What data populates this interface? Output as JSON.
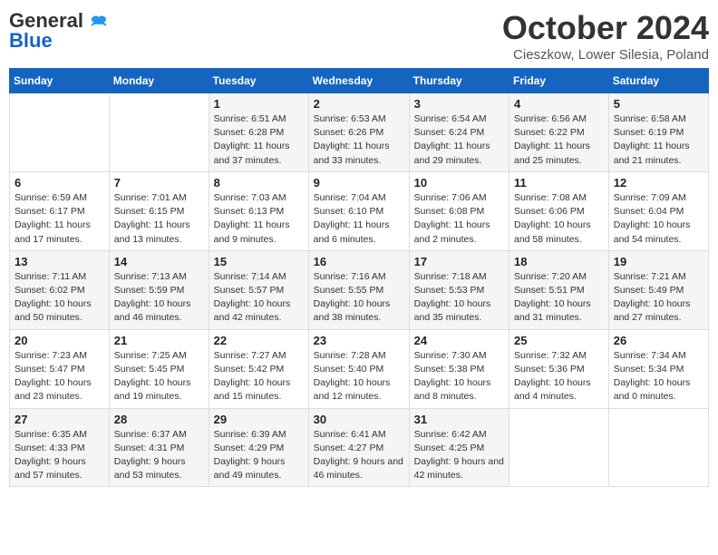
{
  "header": {
    "logo_general": "General",
    "logo_blue": "Blue",
    "month": "October 2024",
    "location": "Cieszkow, Lower Silesia, Poland"
  },
  "weekdays": [
    "Sunday",
    "Monday",
    "Tuesday",
    "Wednesday",
    "Thursday",
    "Friday",
    "Saturday"
  ],
  "weeks": [
    [
      null,
      null,
      {
        "day": "1",
        "sunrise": "6:51 AM",
        "sunset": "6:28 PM",
        "daylight": "11 hours and 37 minutes."
      },
      {
        "day": "2",
        "sunrise": "6:53 AM",
        "sunset": "6:26 PM",
        "daylight": "11 hours and 33 minutes."
      },
      {
        "day": "3",
        "sunrise": "6:54 AM",
        "sunset": "6:24 PM",
        "daylight": "11 hours and 29 minutes."
      },
      {
        "day": "4",
        "sunrise": "6:56 AM",
        "sunset": "6:22 PM",
        "daylight": "11 hours and 25 minutes."
      },
      {
        "day": "5",
        "sunrise": "6:58 AM",
        "sunset": "6:19 PM",
        "daylight": "11 hours and 21 minutes."
      }
    ],
    [
      {
        "day": "6",
        "sunrise": "6:59 AM",
        "sunset": "6:17 PM",
        "daylight": "11 hours and 17 minutes."
      },
      {
        "day": "7",
        "sunrise": "7:01 AM",
        "sunset": "6:15 PM",
        "daylight": "11 hours and 13 minutes."
      },
      {
        "day": "8",
        "sunrise": "7:03 AM",
        "sunset": "6:13 PM",
        "daylight": "11 hours and 9 minutes."
      },
      {
        "day": "9",
        "sunrise": "7:04 AM",
        "sunset": "6:10 PM",
        "daylight": "11 hours and 6 minutes."
      },
      {
        "day": "10",
        "sunrise": "7:06 AM",
        "sunset": "6:08 PM",
        "daylight": "11 hours and 2 minutes."
      },
      {
        "day": "11",
        "sunrise": "7:08 AM",
        "sunset": "6:06 PM",
        "daylight": "10 hours and 58 minutes."
      },
      {
        "day": "12",
        "sunrise": "7:09 AM",
        "sunset": "6:04 PM",
        "daylight": "10 hours and 54 minutes."
      }
    ],
    [
      {
        "day": "13",
        "sunrise": "7:11 AM",
        "sunset": "6:02 PM",
        "daylight": "10 hours and 50 minutes."
      },
      {
        "day": "14",
        "sunrise": "7:13 AM",
        "sunset": "5:59 PM",
        "daylight": "10 hours and 46 minutes."
      },
      {
        "day": "15",
        "sunrise": "7:14 AM",
        "sunset": "5:57 PM",
        "daylight": "10 hours and 42 minutes."
      },
      {
        "day": "16",
        "sunrise": "7:16 AM",
        "sunset": "5:55 PM",
        "daylight": "10 hours and 38 minutes."
      },
      {
        "day": "17",
        "sunrise": "7:18 AM",
        "sunset": "5:53 PM",
        "daylight": "10 hours and 35 minutes."
      },
      {
        "day": "18",
        "sunrise": "7:20 AM",
        "sunset": "5:51 PM",
        "daylight": "10 hours and 31 minutes."
      },
      {
        "day": "19",
        "sunrise": "7:21 AM",
        "sunset": "5:49 PM",
        "daylight": "10 hours and 27 minutes."
      }
    ],
    [
      {
        "day": "20",
        "sunrise": "7:23 AM",
        "sunset": "5:47 PM",
        "daylight": "10 hours and 23 minutes."
      },
      {
        "day": "21",
        "sunrise": "7:25 AM",
        "sunset": "5:45 PM",
        "daylight": "10 hours and 19 minutes."
      },
      {
        "day": "22",
        "sunrise": "7:27 AM",
        "sunset": "5:42 PM",
        "daylight": "10 hours and 15 minutes."
      },
      {
        "day": "23",
        "sunrise": "7:28 AM",
        "sunset": "5:40 PM",
        "daylight": "10 hours and 12 minutes."
      },
      {
        "day": "24",
        "sunrise": "7:30 AM",
        "sunset": "5:38 PM",
        "daylight": "10 hours and 8 minutes."
      },
      {
        "day": "25",
        "sunrise": "7:32 AM",
        "sunset": "5:36 PM",
        "daylight": "10 hours and 4 minutes."
      },
      {
        "day": "26",
        "sunrise": "7:34 AM",
        "sunset": "5:34 PM",
        "daylight": "10 hours and 0 minutes."
      }
    ],
    [
      {
        "day": "27",
        "sunrise": "6:35 AM",
        "sunset": "4:33 PM",
        "daylight": "9 hours and 57 minutes."
      },
      {
        "day": "28",
        "sunrise": "6:37 AM",
        "sunset": "4:31 PM",
        "daylight": "9 hours and 53 minutes."
      },
      {
        "day": "29",
        "sunrise": "6:39 AM",
        "sunset": "4:29 PM",
        "daylight": "9 hours and 49 minutes."
      },
      {
        "day": "30",
        "sunrise": "6:41 AM",
        "sunset": "4:27 PM",
        "daylight": "9 hours and 46 minutes."
      },
      {
        "day": "31",
        "sunrise": "6:42 AM",
        "sunset": "4:25 PM",
        "daylight": "9 hours and 42 minutes."
      },
      null,
      null
    ]
  ]
}
